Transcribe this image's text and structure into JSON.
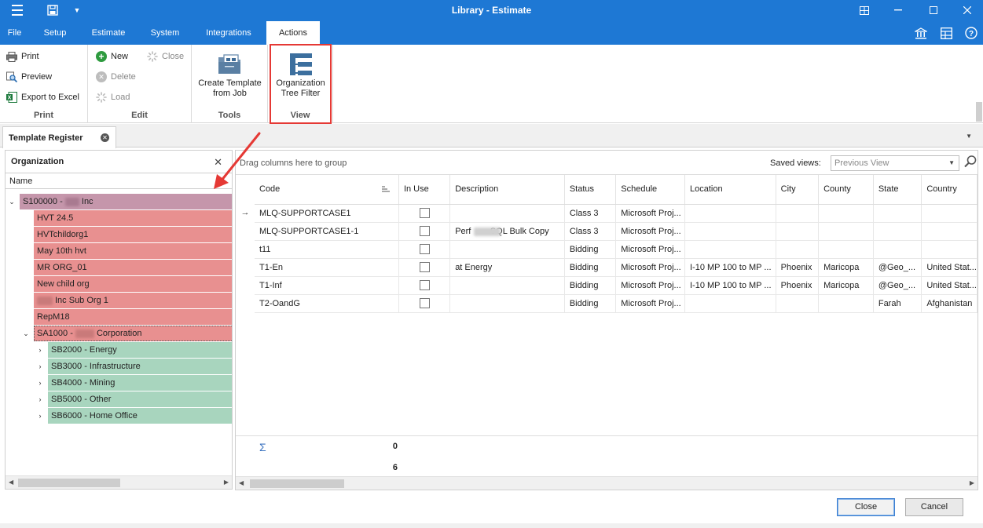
{
  "window": {
    "title": "Library - Estimate"
  },
  "menu": {
    "tabs": [
      {
        "label": "File"
      },
      {
        "label": "Setup"
      },
      {
        "label": "Estimate"
      },
      {
        "label": "System"
      },
      {
        "label": "Integrations"
      },
      {
        "label": "Actions",
        "active": true
      }
    ]
  },
  "ribbon": {
    "print_group": {
      "label": "Print",
      "print": "Print",
      "preview": "Preview",
      "export": "Export to Excel"
    },
    "edit_group": {
      "label": "Edit",
      "new": "New",
      "close": "Close",
      "delete": "Delete",
      "load": "Load"
    },
    "tools_group": {
      "label": "Tools",
      "create_line1": "Create Template",
      "create_line2": "from Job"
    },
    "view_group": {
      "label": "View",
      "org_line1": "Organization",
      "org_line2": "Tree Filter"
    }
  },
  "doc_tab": {
    "label": "Template Register"
  },
  "org_panel": {
    "title": "Organization",
    "name_header": "Name",
    "root": {
      "prefix": "S100000 - ",
      "suffix": " Inc"
    },
    "children": [
      {
        "label": "HVT 24.5"
      },
      {
        "label": "HVTchildorg1"
      },
      {
        "label": "May 10th hvt"
      },
      {
        "label": "MR ORG_01"
      },
      {
        "label": "New child org"
      },
      {
        "label": "Inc Sub Org 1"
      },
      {
        "label": "RepM18"
      }
    ],
    "corp": {
      "prefix": "SA1000 - ",
      "suffix": " Corporation"
    },
    "sub_children": [
      {
        "label": "SB2000 - Energy"
      },
      {
        "label": "SB3000 - Infrastructure"
      },
      {
        "label": "SB4000 - Mining"
      },
      {
        "label": "SB5000 - Other"
      },
      {
        "label": "SB6000 - Home Office"
      }
    ]
  },
  "grid": {
    "group_hint": "Drag columns here to group",
    "saved_views_label": "Saved views:",
    "saved_views_value": "Previous View",
    "columns": {
      "code": "Code",
      "in_use": "In Use",
      "description": "Description",
      "status": "Status",
      "schedule": "Schedule",
      "location": "Location",
      "city": "City",
      "county": "County",
      "state": "State",
      "country": "Country"
    },
    "rows": [
      {
        "code": "MLQ-SUPPORTCASE1",
        "description": "",
        "status": "Class 3",
        "schedule": "Microsoft Proj...",
        "location": "",
        "city": "",
        "county": "",
        "state": "",
        "country": ""
      },
      {
        "code": "MLQ-SUPPORTCASE1-1",
        "description": "Perf        SQL Bulk Copy",
        "status": "Class 3",
        "schedule": "Microsoft Proj...",
        "location": "",
        "city": "",
        "county": "",
        "state": "",
        "country": ""
      },
      {
        "code": "t11",
        "description": "",
        "status": "Bidding",
        "schedule": "Microsoft Proj...",
        "location": "",
        "city": "",
        "county": "",
        "state": "",
        "country": ""
      },
      {
        "code": "T1-En",
        "description": "at Energy",
        "status": "Bidding",
        "schedule": "Microsoft Proj...",
        "location": "I-10 MP 100 to MP ...",
        "city": "Phoenix",
        "county": "Maricopa",
        "state": "@Geo_...",
        "country": "United Stat..."
      },
      {
        "code": "T1-Inf",
        "description": "",
        "status": "Bidding",
        "schedule": "Microsoft Proj...",
        "location": "I-10 MP 100 to MP ...",
        "city": "Phoenix",
        "county": "Maricopa",
        "state": "@Geo_...",
        "country": "United Stat..."
      },
      {
        "code": "T2-OandG",
        "description": "",
        "status": "Bidding",
        "schedule": "Microsoft Proj...",
        "location": "",
        "city": "",
        "county": "",
        "state": "Farah",
        "country": "Afghanistan"
      }
    ],
    "totals": {
      "in_use_sum": "0",
      "count": "6"
    }
  },
  "buttons": {
    "close": "Close",
    "cancel": "Cancel"
  },
  "colors": {
    "accent": "#1e78d4",
    "root_row": "#c596ab",
    "child_row": "#e89090",
    "sub_row": "#a8d5be",
    "highlight": "#e53935"
  }
}
